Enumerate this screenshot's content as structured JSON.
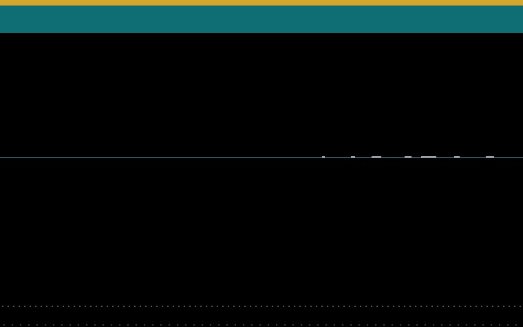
{
  "theme": {
    "accent_color": "#D4A72C",
    "header_color": "#0F6E73",
    "divider_color": "#2B7A8C",
    "background_color": "#000000"
  }
}
